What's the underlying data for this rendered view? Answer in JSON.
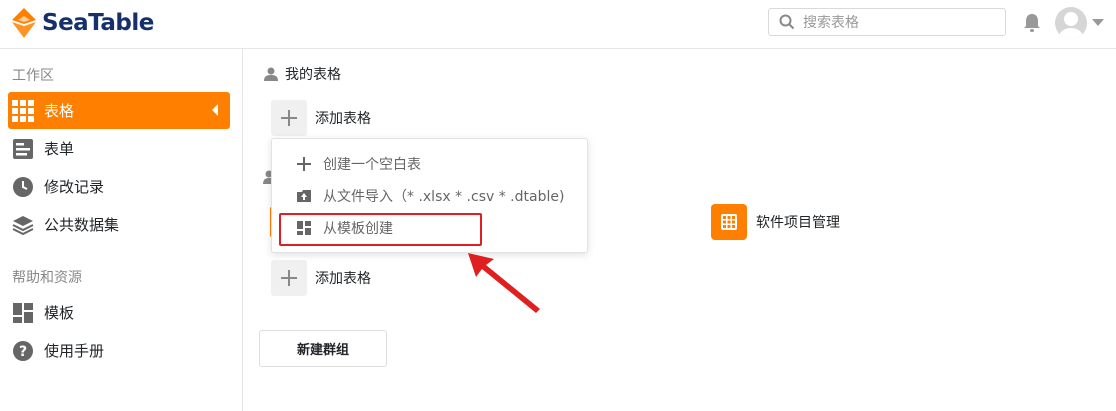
{
  "header": {
    "logo_text": "SeaTable",
    "search_placeholder": "搜索表格",
    "brand_color": "#ff8000",
    "logo_text_color": "#15306b"
  },
  "sidebar": {
    "workspace_title": "工作区",
    "items": [
      {
        "label": "表格",
        "icon": "grid-icon",
        "active": true
      },
      {
        "label": "表单",
        "icon": "form-icon"
      },
      {
        "label": "修改记录",
        "icon": "clock-icon"
      },
      {
        "label": "公共数据集",
        "icon": "layers-icon"
      }
    ],
    "help_title": "帮助和资源",
    "help_items": [
      {
        "label": "模板",
        "icon": "template-icon"
      },
      {
        "label": "使用手册",
        "icon": "help-icon"
      }
    ]
  },
  "main": {
    "my_tables_title": "我的表格",
    "add_table_label": "添加表格",
    "dropdown": [
      {
        "label": "创建一个空白表",
        "icon": "plus-icon"
      },
      {
        "label": "从文件导入（* .xlsx * .csv * .dtable)",
        "icon": "import-icon"
      },
      {
        "label": "从模板创建",
        "icon": "template-icon"
      }
    ],
    "group_table_name": "软件项目管理",
    "group_add_table_label": "添加表格",
    "new_group_label": "新建群组"
  },
  "annotation_color": "#e02020"
}
